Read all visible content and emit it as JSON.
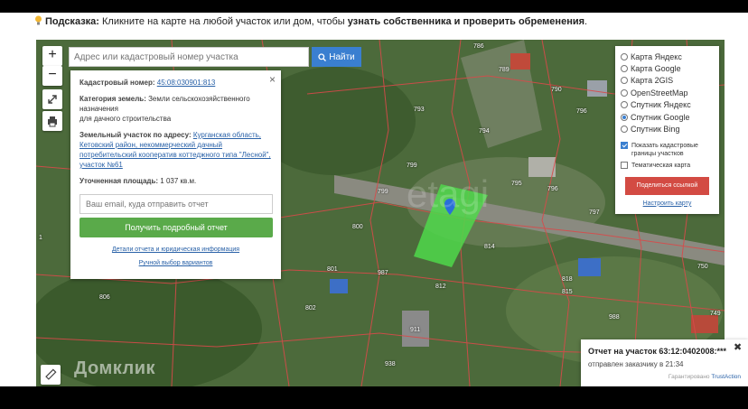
{
  "hint": {
    "label": "Подсказка:",
    "text": " Кликните на карте на любой участок или дом, чтобы ",
    "bold": "узнать собственника и проверить обременения",
    "end": "."
  },
  "map_controls": {
    "zoom_in": "+",
    "zoom_out": "−"
  },
  "search": {
    "placeholder": "Адрес или кадастровый номер участка",
    "button_label": "Найти"
  },
  "info_panel": {
    "close": "×",
    "cadastral_label": "Кадастровый номер:",
    "cadastral_value": "45:08:030901:813",
    "category_label": "Категория земель:",
    "category_value": "Земли сельскохозяйственного назначения",
    "category_value2": "для дачного строительства",
    "address_label": "Земельный участок по адресу:",
    "address_value": "Курганская область, Кетовский район, некоммерческий дачный потребительский кооператив коттеджного типа \"Лесной\", участок №61",
    "area_label": "Уточненная площадь:",
    "area_value": "1 037 кв.м.",
    "email_placeholder": "Ваш email, куда отправить отчет",
    "report_button": "Получить подробный отчет",
    "details_link": "Детали отчета и юридическая информация",
    "manual_link": "Ручной выбор вариантов"
  },
  "layers": {
    "options": [
      {
        "label": "Карта Яндекс",
        "selected": false
      },
      {
        "label": "Карта Google",
        "selected": false
      },
      {
        "label": "Карта 2GIS",
        "selected": false
      },
      {
        "label": "OpenStreetMap",
        "selected": false
      },
      {
        "label": "Спутник Яндекс",
        "selected": false
      },
      {
        "label": "Спутник Google",
        "selected": true
      },
      {
        "label": "Спутник Bing",
        "selected": false
      }
    ],
    "show_borders": "Показать кадастровые границы участков",
    "thematic": "Тематическая карта",
    "share_button": "Поделиться ссылкой",
    "reset_link": "Настроить карту"
  },
  "notification": {
    "title": "Отчет на участок 63:12:0402008:***",
    "subtitle": "отправлен заказчику в 21:34",
    "guarantee": "Гарантировано ",
    "guarantee_link": "TrustAction"
  },
  "watermark": "Домклик",
  "plots": [
    "786",
    "789",
    "790",
    "793",
    "796",
    "794",
    "799",
    "799",
    "795",
    "796",
    "797",
    "800",
    "814",
    "801",
    "987",
    "812",
    "806",
    "802",
    "818",
    "815",
    "911",
    "988",
    "750",
    "749",
    "938",
    "1"
  ],
  "colors": {
    "accent_blue": "#3a7fd0",
    "report_green": "#5aaa4a",
    "share_red": "#d34b43",
    "highlight_plot": "#4fd84b",
    "borders": "#d84a4a"
  }
}
